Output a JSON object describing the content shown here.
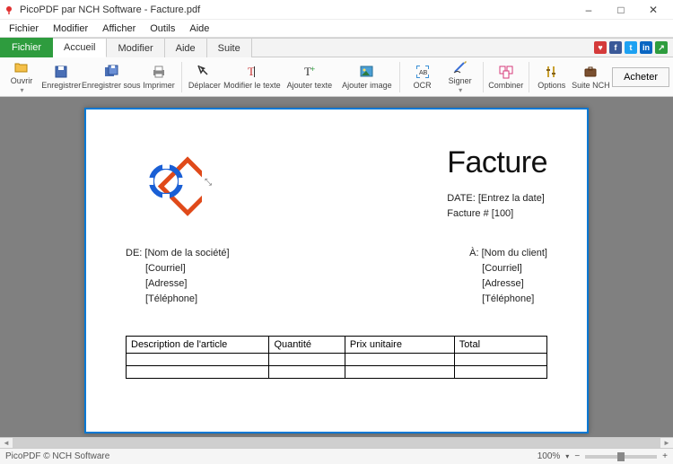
{
  "window": {
    "title": "PicoPDF par NCH Software - Facture.pdf"
  },
  "menu": {
    "file": "Fichier",
    "edit": "Modifier",
    "view": "Afficher",
    "tools": "Outils",
    "help": "Aide"
  },
  "tabs": {
    "file": "Fichier",
    "home": "Accueil",
    "edit": "Modifier",
    "help": "Aide",
    "suite": "Suite"
  },
  "toolbar": {
    "open": "Ouvrir",
    "save": "Enregistrer",
    "saveas": "Enregistrer sous",
    "print": "Imprimer",
    "move": "Déplacer",
    "edittext": "Modifier le texte",
    "addtext": "Ajouter texte",
    "addimage": "Ajouter image",
    "ocr": "OCR",
    "sign": "Signer",
    "combine": "Combiner",
    "options": "Options",
    "suite": "Suite NCH",
    "buy": "Acheter"
  },
  "doc": {
    "title": "Facture",
    "date_label": "DATE:",
    "date_value": "[Entrez la date]",
    "invnum_label": "Facture #",
    "invnum_value": "[100]",
    "from_label": "DE:",
    "to_label": "À:",
    "from": {
      "company": "[Nom de la société]",
      "email": "[Courriel]",
      "address": "[Adresse]",
      "phone": "[Téléphone]"
    },
    "to": {
      "client": "[Nom du client]",
      "email": "[Courriel]",
      "address": "[Adresse]",
      "phone": "[Téléphone]"
    },
    "columns": {
      "desc": "Description de l'article",
      "qty": "Quantité",
      "price": "Prix unitaire",
      "total": "Total"
    }
  },
  "status": {
    "copyright": "PicoPDF © NCH Software",
    "zoom": "100%"
  }
}
